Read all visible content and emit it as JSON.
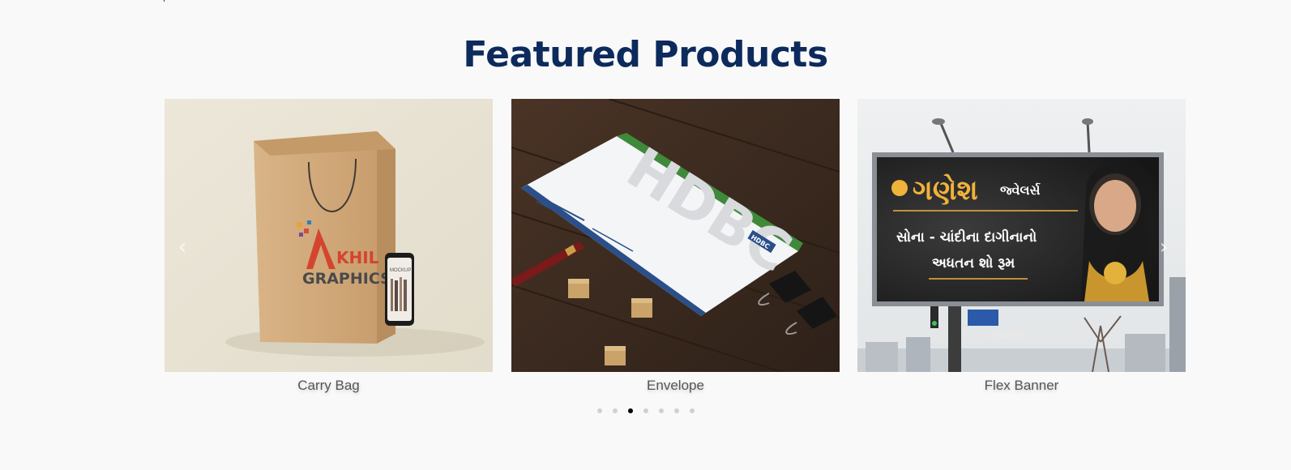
{
  "header": {
    "title": "Featured Products"
  },
  "carousel": {
    "prev_icon": "chevron-left-icon",
    "next_icon": "chevron-right-icon",
    "prev_glyph": "‹",
    "next_glyph": "›",
    "products": [
      {
        "name": "Carry Bag",
        "image_text": {
          "brand_line1": "KHIL",
          "brand_line2": "GRAPHICS",
          "phone_label": "MOCKUP"
        }
      },
      {
        "name": "Envelope",
        "image_text": {
          "watermark": "HDBC",
          "logo": "HDBC"
        }
      },
      {
        "name": "Flex Banner",
        "image_text": {
          "shop_name": "ગણેશ",
          "shop_suffix": "જ્વેલર્સ",
          "line1": "સોના - ચાંદીના દાગીનાનો",
          "line2": "અધતન શો રૂમ"
        }
      }
    ],
    "pagination": {
      "total": 7,
      "active_index": 2
    }
  },
  "colors": {
    "background": "#f9f9f9",
    "title": "#0d2a5c",
    "caption": "#555555",
    "dot_inactive": "#d0d0d0",
    "dot_active": "#000000"
  }
}
